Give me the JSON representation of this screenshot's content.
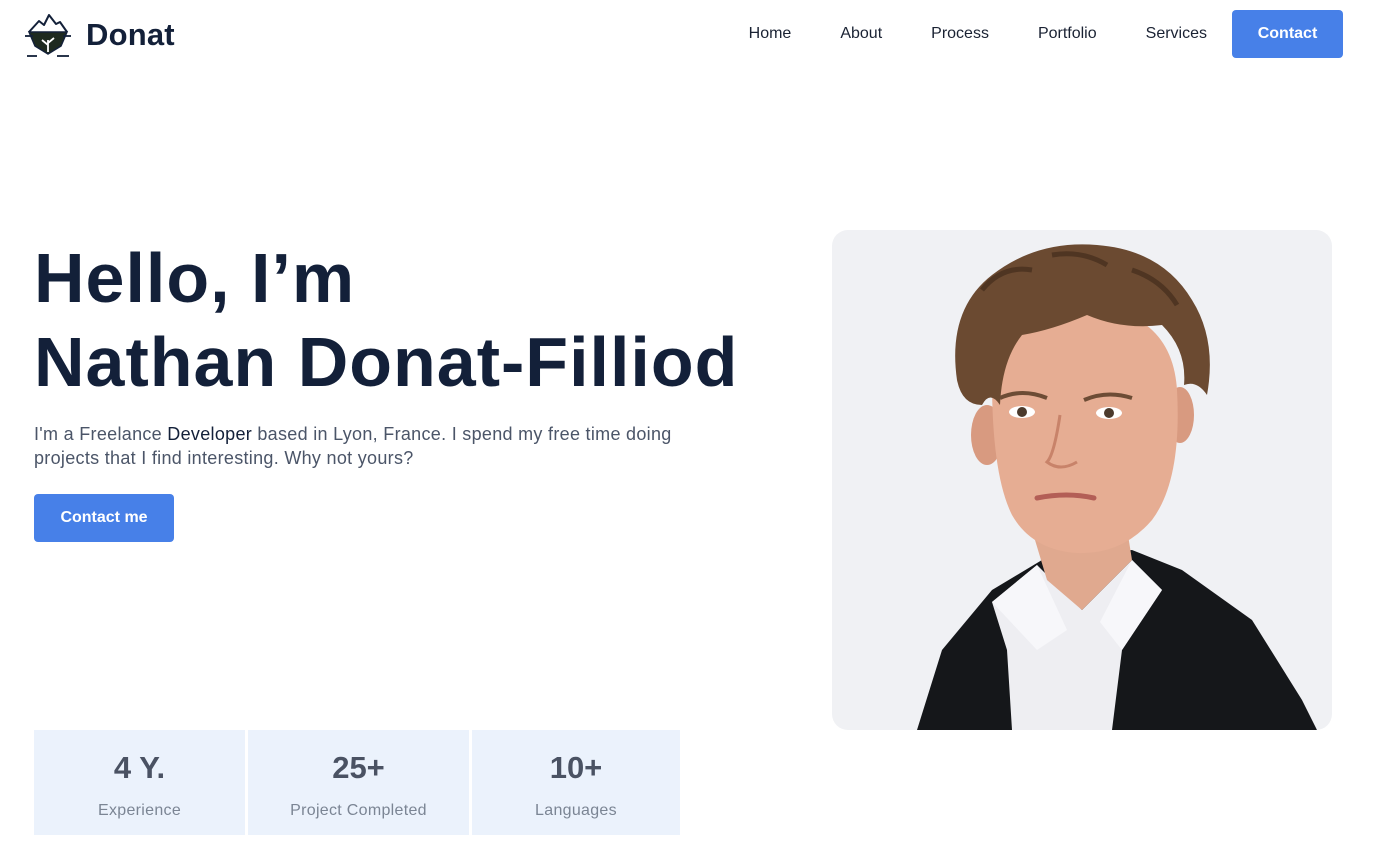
{
  "brand": {
    "name": "Donat",
    "logo_icon": "iceberg-logo-icon"
  },
  "nav": {
    "items": [
      {
        "label": "Home"
      },
      {
        "label": "About"
      },
      {
        "label": "Process"
      },
      {
        "label": "Portfolio"
      },
      {
        "label": "Services"
      }
    ],
    "contact_label": "Contact"
  },
  "hero": {
    "title_line1": "Hello, I’m",
    "title_line2": "Nathan Donat-Filliod",
    "text_before": "I'm a Freelance ",
    "text_highlight": "Developer",
    "text_after": " based in Lyon, France. I spend my free time doing projects that I find interesting. Why not yours?",
    "cta_label": "Contact me"
  },
  "photo": {
    "icon": "portrait-photo"
  },
  "stats": [
    {
      "value": "4 Y.",
      "label": "Experience"
    },
    {
      "value": "25+",
      "label": "Project Completed"
    },
    {
      "value": "10+",
      "label": "Languages"
    }
  ],
  "colors": {
    "primary": "#4780e8",
    "heading": "#132039",
    "body_text": "#4b5568",
    "stat_bg": "#ebf2fc",
    "photo_bg": "#f0f1f4"
  }
}
